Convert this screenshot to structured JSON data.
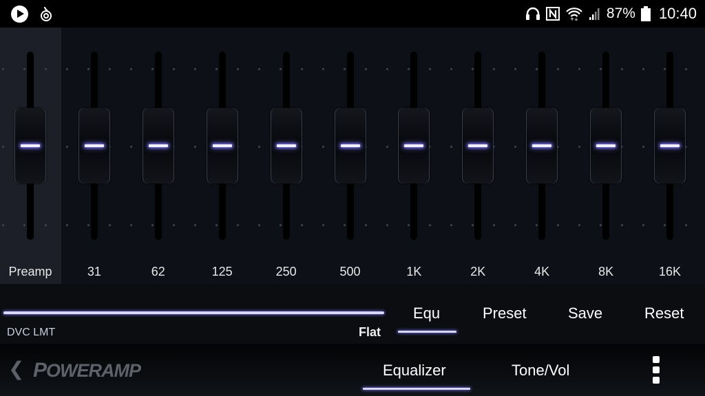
{
  "status_bar": {
    "left_icons": [
      "play-icon",
      "app-notification-icon"
    ],
    "right_icons": [
      "headphones-icon",
      "nfc-icon",
      "wifi-icon",
      "signal-icon"
    ],
    "battery_percent": "87%",
    "battery_icon": "battery-icon",
    "time": "10:40"
  },
  "equalizer": {
    "bands": [
      {
        "label": "Preamp",
        "value_db": 0,
        "selected": true
      },
      {
        "label": "31",
        "value_db": 0
      },
      {
        "label": "62",
        "value_db": 0
      },
      {
        "label": "125",
        "value_db": 0
      },
      {
        "label": "250",
        "value_db": 0
      },
      {
        "label": "500",
        "value_db": 0
      },
      {
        "label": "1K",
        "value_db": 0
      },
      {
        "label": "2K",
        "value_db": 0
      },
      {
        "label": "4K",
        "value_db": 0
      },
      {
        "label": "8K",
        "value_db": 0
      },
      {
        "label": "16K",
        "value_db": 0
      }
    ]
  },
  "controls": {
    "dvc_label": "DVC LMT",
    "dvc_fill": 1.0,
    "preset_name": "Flat",
    "buttons": [
      {
        "label": "Equ",
        "active": true
      },
      {
        "label": "Preset"
      },
      {
        "label": "Save"
      },
      {
        "label": "Reset"
      }
    ]
  },
  "bottom_bar": {
    "back_glyph": "❮",
    "logo_text_first": "P",
    "logo_text_rest": "OWERAMP",
    "tabs": [
      {
        "label": "Equalizer",
        "active": true
      },
      {
        "label": "Tone/Vol"
      }
    ],
    "menu_icon": "more-vert-icon"
  },
  "colors": {
    "accent": "#d9d6ff",
    "accent_glow": "#8b84ff",
    "background": "#0d1017",
    "preamp_background": "#1c1f27"
  }
}
